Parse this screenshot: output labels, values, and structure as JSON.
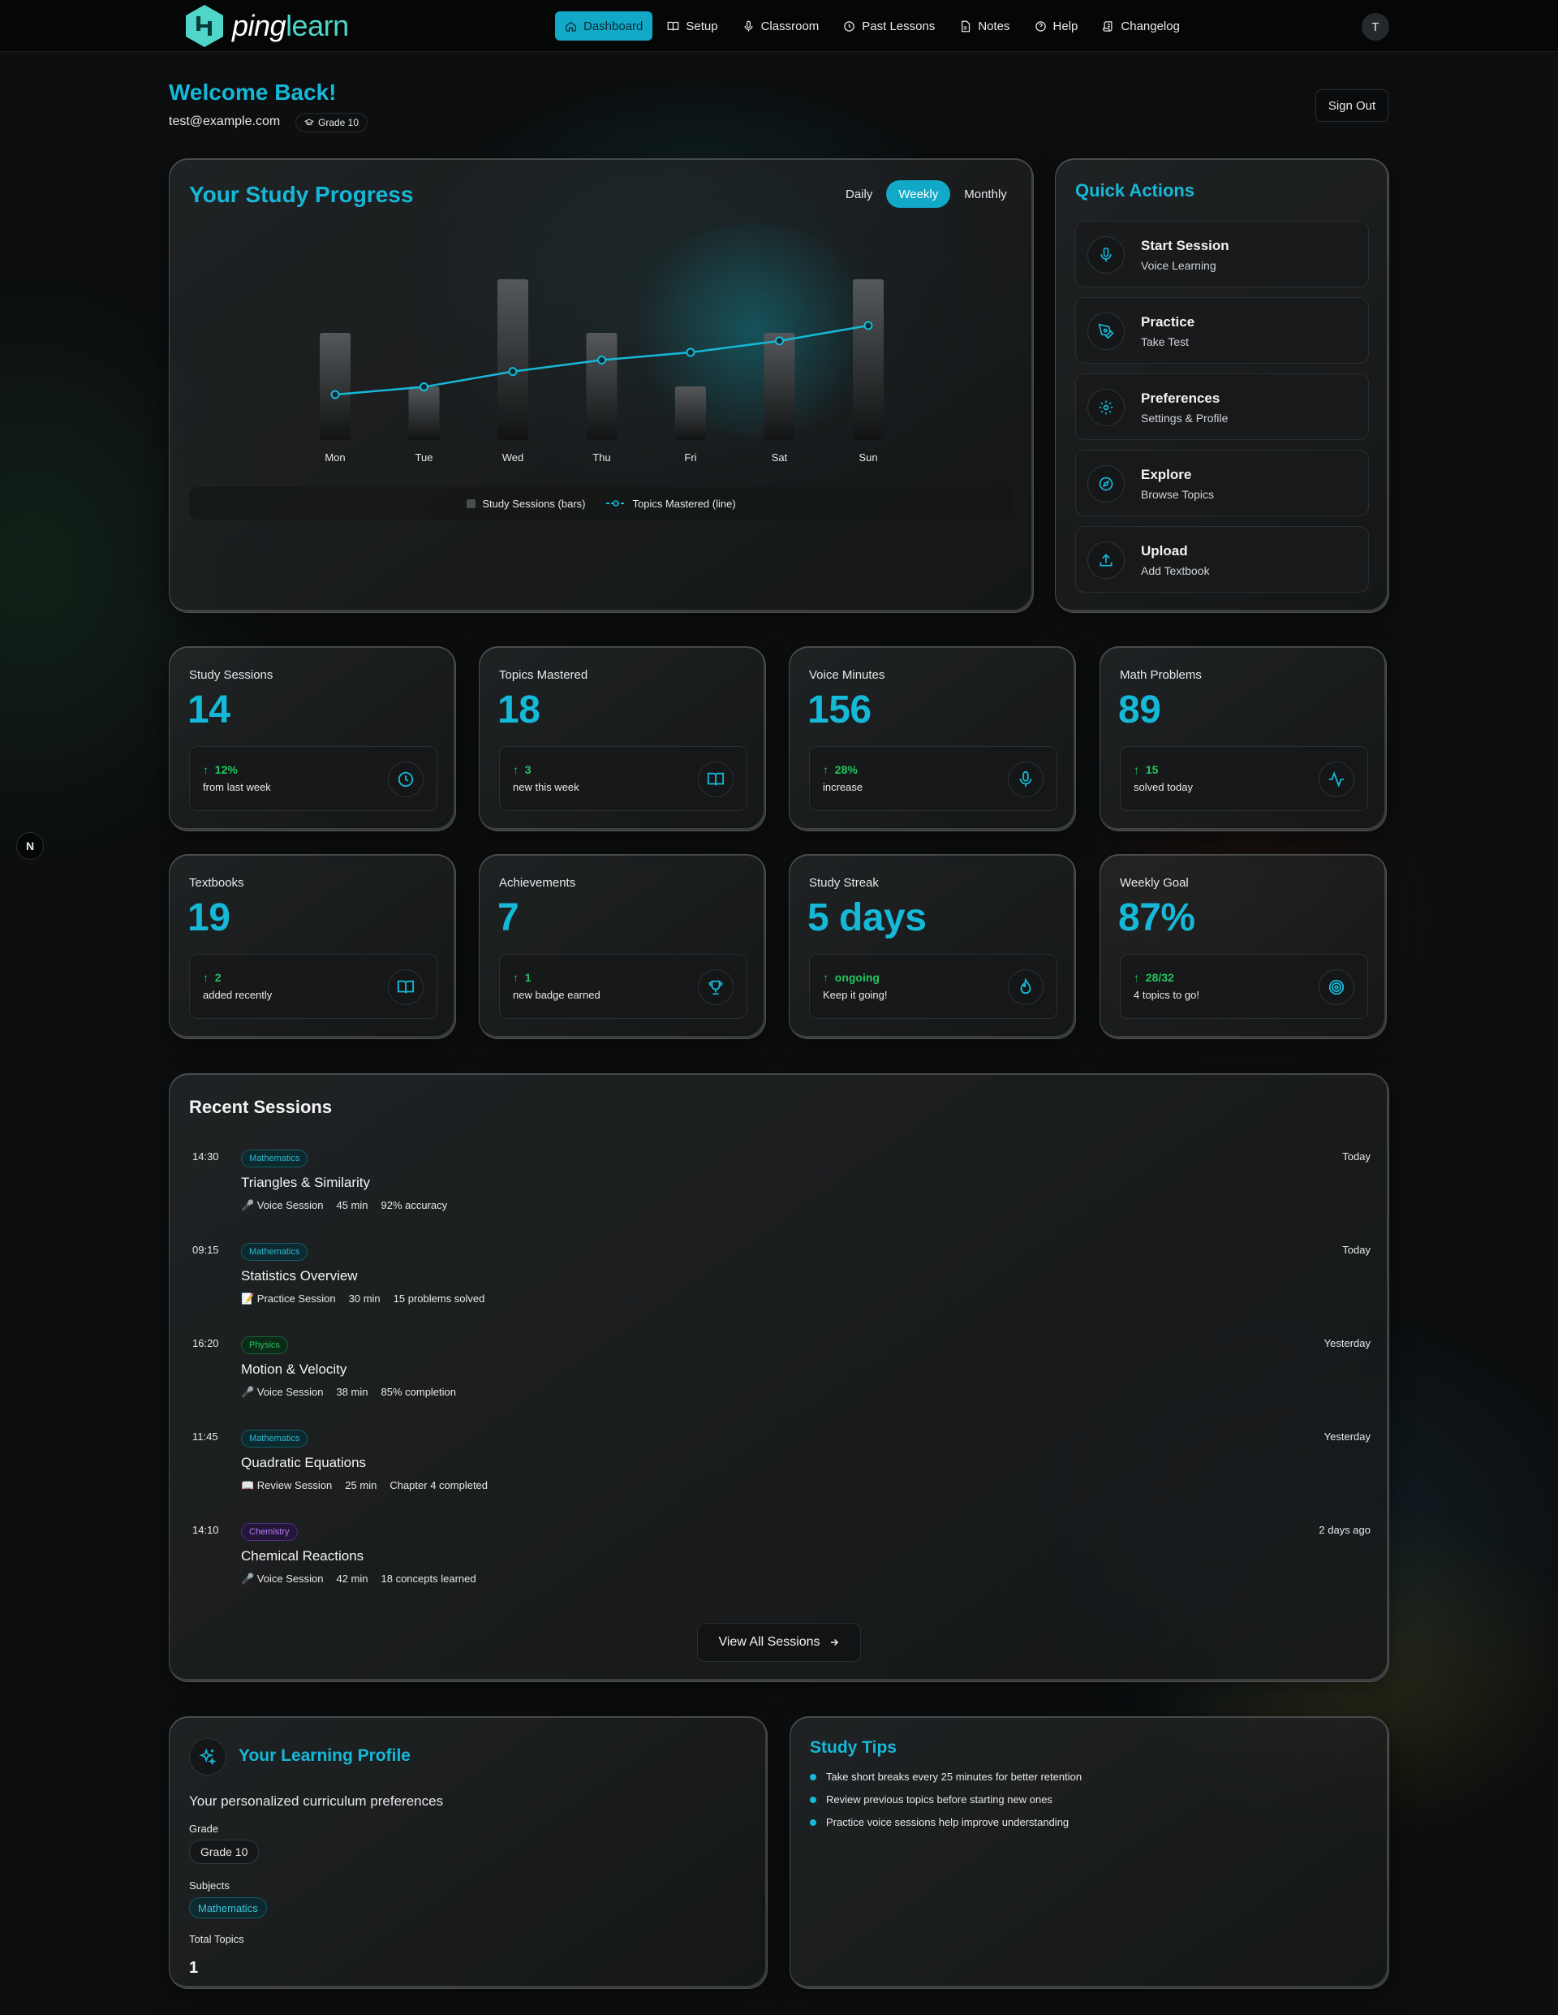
{
  "brand": {
    "part1": "ping",
    "part2": "learn",
    "accent": "#16b8d8"
  },
  "nav": {
    "items": [
      {
        "label": "Dashboard",
        "icon": "home-icon"
      },
      {
        "label": "Setup",
        "icon": "book-open-icon"
      },
      {
        "label": "Classroom",
        "icon": "microphone-icon"
      },
      {
        "label": "Past Lessons",
        "icon": "clock-icon"
      },
      {
        "label": "Notes",
        "icon": "document-icon"
      },
      {
        "label": "Help",
        "icon": "help-circle-icon"
      },
      {
        "label": "Changelog",
        "icon": "scroll-icon"
      }
    ],
    "active": "Dashboard",
    "avatar_initial": "T"
  },
  "header": {
    "welcome": "Welcome Back!",
    "email": "test@example.com",
    "grade_badge": "Grade 10",
    "sign_out": "Sign Out"
  },
  "progress": {
    "title": "Your Study Progress",
    "periods": [
      "Daily",
      "Weekly",
      "Monthly"
    ],
    "active_period": "Weekly"
  },
  "chart_data": {
    "type": "bar",
    "categories": [
      "Mon",
      "Tue",
      "Wed",
      "Thu",
      "Fri",
      "Sat",
      "Sun"
    ],
    "series": [
      {
        "name": "Study Sessions (bars)",
        "type": "bar",
        "values": [
          2,
          1,
          3,
          2,
          1,
          2,
          3
        ]
      },
      {
        "name": "Topics Mastered (line)",
        "type": "line",
        "values": [
          1,
          2,
          4,
          5.5,
          6.5,
          8,
          10
        ]
      }
    ],
    "legend_position": "bottom",
    "line_color": "#16b8d8",
    "bar_color": "#4a4d50"
  },
  "quick_actions": {
    "title": "Quick Actions",
    "items": [
      {
        "label": "Start Session",
        "sub": "Voice Learning",
        "icon": "microphone-icon"
      },
      {
        "label": "Practice",
        "sub": "Take Test",
        "icon": "pen-tool-icon"
      },
      {
        "label": "Preferences",
        "sub": "Settings & Profile",
        "icon": "gear-icon"
      },
      {
        "label": "Explore",
        "sub": "Browse Topics",
        "icon": "compass-icon"
      },
      {
        "label": "Upload",
        "sub": "Add Textbook",
        "icon": "upload-icon"
      }
    ]
  },
  "stats": [
    {
      "label": "Study Sessions",
      "value": "14",
      "change": "12%",
      "note": "from last week",
      "icon": "clock-icon"
    },
    {
      "label": "Topics Mastered",
      "value": "18",
      "change": "3",
      "note": "new this week",
      "icon": "book-open-icon"
    },
    {
      "label": "Voice Minutes",
      "value": "156",
      "change": "28%",
      "note": "increase",
      "icon": "microphone-icon"
    },
    {
      "label": "Math Problems",
      "value": "89",
      "change": "15",
      "note": "solved today",
      "icon": "activity-icon"
    },
    {
      "label": "Textbooks",
      "value": "19",
      "change": "2",
      "note": "added recently",
      "icon": "book-open-icon"
    },
    {
      "label": "Achievements",
      "value": "7",
      "change": "1",
      "note": "new badge earned",
      "icon": "trophy-icon"
    },
    {
      "label": "Study Streak",
      "value": "5 days",
      "change": "ongoing",
      "note": "Keep it going!",
      "icon": "flame-icon"
    },
    {
      "label": "Weekly Goal",
      "value": "87%",
      "change": "28/32",
      "note": "4 topics to go!",
      "icon": "target-icon"
    }
  ],
  "sessions": {
    "title": "Recent Sessions",
    "items": [
      {
        "time": "14:30",
        "subject": "Mathematics",
        "title": "Triangles & Similarity",
        "kind": "🎤 Voice Session",
        "duration": "45 min",
        "detail": "92% accuracy",
        "day": "Today"
      },
      {
        "time": "09:15",
        "subject": "Mathematics",
        "title": "Statistics Overview",
        "kind": "📝 Practice Session",
        "duration": "30 min",
        "detail": "15 problems solved",
        "day": "Today"
      },
      {
        "time": "16:20",
        "subject": "Physics",
        "title": "Motion & Velocity",
        "kind": "🎤 Voice Session",
        "duration": "38 min",
        "detail": "85% completion",
        "day": "Yesterday"
      },
      {
        "time": "11:45",
        "subject": "Mathematics",
        "title": "Quadratic Equations",
        "kind": "📖 Review Session",
        "duration": "25 min",
        "detail": "Chapter 4 completed",
        "day": "Yesterday"
      },
      {
        "time": "14:10",
        "subject": "Chemistry",
        "title": "Chemical Reactions",
        "kind": "🎤 Voice Session",
        "duration": "42 min",
        "detail": "18 concepts learned",
        "day": "2 days ago"
      }
    ],
    "view_all": "View All Sessions",
    "subject_colors": {
      "Mathematics": {
        "text": "#2ab8d0",
        "bg": "#0d2a30",
        "border": "#145b66"
      },
      "Physics": {
        "text": "#22c55e",
        "bg": "#0d2a18",
        "border": "#17603a"
      },
      "Chemistry": {
        "text": "#b27bf0",
        "bg": "#24163a",
        "border": "#4d2f7a"
      }
    }
  },
  "profile": {
    "title": "Your Learning Profile",
    "desc": "Your personalized curriculum preferences",
    "grade_label": "Grade",
    "grade_value": "Grade 10",
    "subjects_label": "Subjects",
    "subjects": [
      "Mathematics"
    ],
    "total_label": "Total Topics",
    "total_value": "1"
  },
  "tips": {
    "title": "Study Tips",
    "items": [
      "Take short breaks every 25 minutes for better retention",
      "Review previous topics before starting new ones",
      "Practice voice sessions help improve understanding"
    ]
  },
  "dev_badge": "N"
}
